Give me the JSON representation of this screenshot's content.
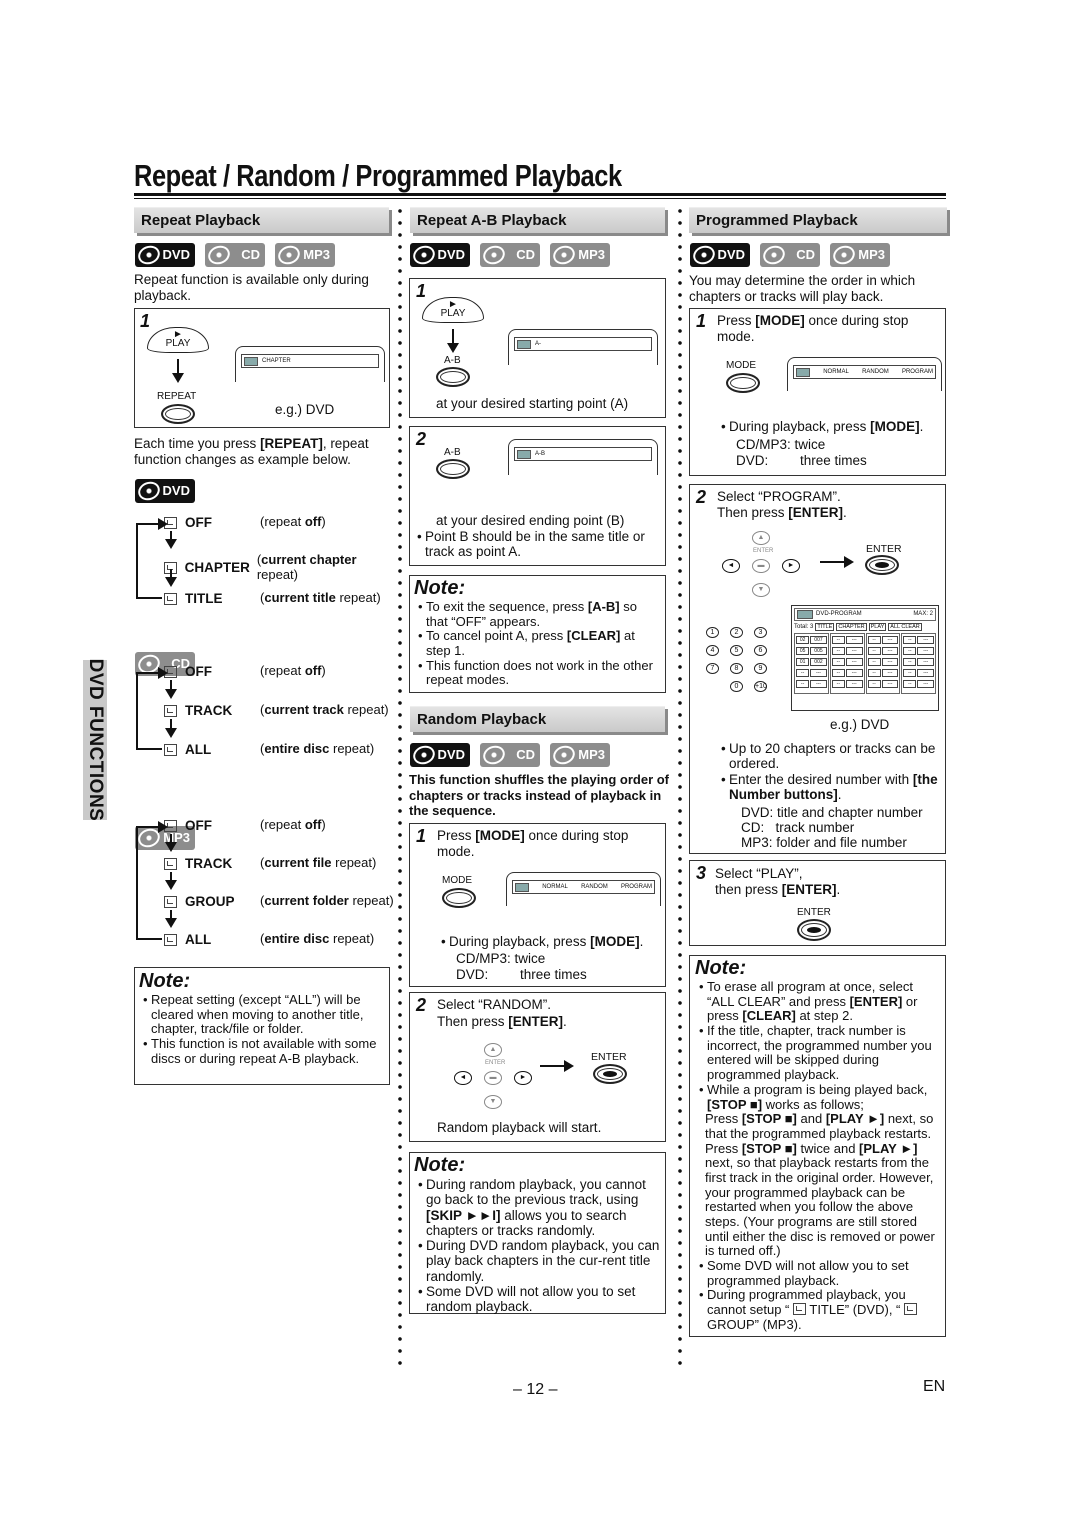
{
  "page": {
    "title": "Repeat / Random / Programmed Playback",
    "side_tab": "DVD FUNCTIONS",
    "page_number": "– 12 –",
    "language": "EN"
  },
  "badges": {
    "dvd": "DVD",
    "cd": "CD",
    "mp3": "MP3"
  },
  "repeat": {
    "heading": "Repeat Playback",
    "intro": "Repeat function is available only during playback.",
    "step1": {
      "num": "1",
      "play_label": "PLAY",
      "repeat_label": "REPEAT",
      "screen_text": "CHAPTER",
      "caption": "e.g.) DVD"
    },
    "each_time_pre": "Each time you press ",
    "each_time_key": "[REPEAT]",
    "each_time_post": ", repeat function changes as example below.",
    "dvd_modes": [
      {
        "label": "OFF",
        "desc_pre": "(repeat ",
        "desc_bold": "off",
        "desc_post": ")"
      },
      {
        "label": "CHAPTER",
        "desc_pre": "(",
        "desc_bold": "current chapter",
        "desc_post": " repeat)"
      },
      {
        "label": "TITLE",
        "desc_pre": "(",
        "desc_bold": "current title",
        "desc_post": " repeat)"
      }
    ],
    "cd_modes": [
      {
        "label": "OFF",
        "desc_pre": "(repeat ",
        "desc_bold": "off",
        "desc_post": ")"
      },
      {
        "label": "TRACK",
        "desc_pre": "(",
        "desc_bold": "current track",
        "desc_post": " repeat)"
      },
      {
        "label": "ALL",
        "desc_pre": "(",
        "desc_bold": "entire disc",
        "desc_post": " repeat)"
      }
    ],
    "mp3_modes": [
      {
        "label": "OFF",
        "desc_pre": "(repeat ",
        "desc_bold": "off",
        "desc_post": ")"
      },
      {
        "label": "TRACK",
        "desc_pre": "(",
        "desc_bold": "current file",
        "desc_post": " repeat)"
      },
      {
        "label": "GROUP",
        "desc_pre": "(",
        "desc_bold": "current folder",
        "desc_post": " repeat)"
      },
      {
        "label": "ALL",
        "desc_pre": "(",
        "desc_bold": "entire disc",
        "desc_post": " repeat)"
      }
    ],
    "note_title": "Note:",
    "notes": [
      "Repeat setting (except “ALL”) will be cleared when moving to another title, chapter, track/file or folder.",
      "This function is not available with some discs or during repeat A-B playback."
    ]
  },
  "ab": {
    "heading": "Repeat A-B Playback",
    "step1": {
      "num": "1",
      "play_label": "PLAY",
      "ab_label": "A-B",
      "screen_text": "A-",
      "caption": "at your desired starting point (A)"
    },
    "step2": {
      "num": "2",
      "ab_label": "A-B",
      "screen_text": "A-B",
      "caption": "at your desired ending point (B)",
      "bullet": "Point B should be in the same title or track as point A."
    },
    "note_title": "Note:",
    "notes": [
      {
        "pre": "To exit the sequence, press ",
        "bold": "[A-B]",
        "post": " so that “OFF” appears."
      },
      {
        "pre": "To cancel point A, press ",
        "bold": "[CLEAR]",
        "post": " at step 1."
      },
      {
        "pre": "This function does not work in the other repeat modes.",
        "bold": "",
        "post": ""
      }
    ]
  },
  "random": {
    "heading": "Random Playback",
    "intro": "This function shuffles the playing order of chapters or tracks instead of playback in the sequence.",
    "step1": {
      "num": "1",
      "text_pre": "Press ",
      "text_bold": "[MODE]",
      "text_post": " once during stop mode.",
      "mode_label": "MODE",
      "screen_items": [
        "NORMAL",
        "RANDOM",
        "PROGRAM"
      ],
      "bullet_pre": "During playback, press ",
      "bullet_bold": "[MODE]",
      "bullet_post": ".",
      "cd_line": "CD/MP3: twice",
      "dvd_line_label": "DVD:",
      "dvd_line_value": "three times"
    },
    "step2": {
      "num": "2",
      "line1": "Select “RANDOM”.",
      "line2_pre": "Then press ",
      "line2_bold": "[ENTER]",
      "line2_post": ".",
      "enter_small": "ENTER",
      "enter_label": "ENTER",
      "caption": "Random playback will start."
    },
    "note_title": "Note:",
    "notes": [
      {
        "pre": "During random playback, you cannot go back to the previous track, using ",
        "bold": "[SKIP ►►I]",
        "post": " allows you to search chapters or tracks randomly."
      },
      {
        "pre": "During DVD random playback, you can play back chapters in the cur-rent title randomly.",
        "bold": "",
        "post": ""
      },
      {
        "pre": "Some DVD will not allow you to set random playback.",
        "bold": "",
        "post": ""
      }
    ]
  },
  "program": {
    "heading": "Programmed Playback",
    "intro": "You may determine the order in which chapters or tracks will play back.",
    "step1": {
      "num": "1",
      "text_pre": "Press ",
      "text_bold": "[MODE]",
      "text_post": " once during stop mode.",
      "mode_label": "MODE",
      "screen_items": [
        "NORMAL",
        "RANDOM",
        "PROGRAM"
      ],
      "bullet_pre": "During playback, press ",
      "bullet_bold": "[MODE]",
      "bullet_post": ".",
      "cd_line": "CD/MP3: twice",
      "dvd_line_label": "DVD:",
      "dvd_line_value": "three times"
    },
    "step2": {
      "num": "2",
      "line1": "Select “PROGRAM”.",
      "line2_pre": "Then press ",
      "line2_bold": "[ENTER]",
      "line2_post": ".",
      "enter_small": "ENTER",
      "enter_label": "ENTER",
      "number_keys": [
        "1",
        "2",
        "3",
        "4",
        "5",
        "6",
        "7",
        "8",
        "9",
        "0",
        "+10"
      ],
      "screen": {
        "title": "DVD-PROGRAM",
        "max": "MAX:  2",
        "total": "Total:  3",
        "buttons": [
          "TITLE",
          "CHAPTER",
          "PLAY",
          "ALL CLEAR"
        ],
        "entries": [
          [
            "02",
            "007"
          ],
          [
            "05",
            "005"
          ],
          [
            "01",
            "002"
          ]
        ],
        "empty_title": "--",
        "empty_chapter": "---"
      },
      "caption": "e.g.) DVD",
      "bullet1": "Up to 20 chapters or tracks can be ordered.",
      "bullet2_pre": "Enter the desired number with ",
      "bullet2_bold": "[the Number buttons]",
      "bullet2_post": ".",
      "sub_lines": [
        "DVD: title and chapter number",
        "CD:   track number",
        "MP3: folder and file number"
      ]
    },
    "step3": {
      "num": "3",
      "line1": "Select “PLAY”,",
      "line2_pre": "then press ",
      "line2_bold": "[ENTER]",
      "line2_post": ".",
      "enter_label": "ENTER"
    },
    "note_title": "Note:",
    "notes": [
      {
        "pre": "To erase all program at once, select “ALL CLEAR” and press ",
        "bold": "[ENTER]",
        "mid": " or press ",
        "bold2": "[CLEAR]",
        "post": " at step 2."
      },
      {
        "pre": "If the title, chapter, track number is incorrect, the programmed number you entered will be skipped during programmed playback.",
        "bold": "",
        "mid": "",
        "bold2": "",
        "post": ""
      },
      {
        "pre": "While a program is being played back, ",
        "bold": "[STOP ■]",
        "mid": " works as follows;",
        "bold2": "",
        "post": ""
      }
    ],
    "note_stop1_pre": "Press ",
    "note_stop1_b1": "[STOP ■]",
    "note_stop1_mid": " and ",
    "note_stop1_b2": "[PLAY ►]",
    "note_stop1_post": " next, so that the programmed playback restarts.",
    "note_stop2_pre": "Press ",
    "note_stop2_b1": "[STOP ■]",
    "note_stop2_mid": " twice and ",
    "note_stop2_b2": "[PLAY ►]",
    "note_stop2_post": " next, so that playback restarts from the first track in the original order. However, your programmed playback can be restarted when you follow the above steps. (Your programs are still stored until either the disc is removed or power is turned off.)",
    "note_last1": "Some DVD will not allow you to set programmed playback.",
    "note_last2_pre": "During programmed playback, you cannot setup “ ",
    "note_last2_mid": " TITLE” (DVD), “ ",
    "note_last2_post": " GROUP” (MP3)."
  }
}
